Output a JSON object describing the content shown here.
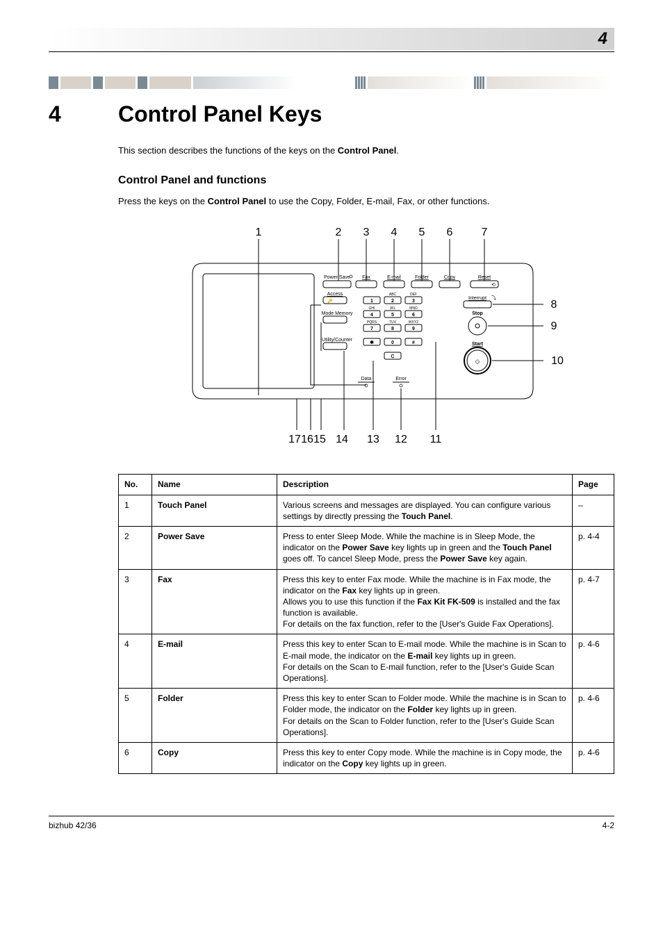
{
  "header": {
    "number": "4"
  },
  "chapter": {
    "num": "4",
    "title": "Control Panel Keys"
  },
  "intro_a": "This section describes the functions of the keys on the ",
  "intro_b": "Control Panel",
  "intro_c": ".",
  "section": {
    "title": "Control Panel and functions"
  },
  "section_desc_a": "Press the keys on the ",
  "section_desc_b": "Control Panel",
  "section_desc_c": " to use the Copy, Folder, E-mail, Fax, or other functions.",
  "diagram": {
    "top": {
      "l1": "1",
      "l2": "2",
      "l3": "3",
      "l4": "4",
      "l5": "5",
      "l6": "6",
      "l7": "7"
    },
    "right": {
      "l8": "8",
      "l9": "9",
      "l10": "10"
    },
    "bottom": {
      "l11": "11",
      "l12": "12",
      "l13": "13",
      "l14": "14",
      "l15": "15",
      "l16": "16",
      "l17": "17"
    },
    "panel": {
      "powersave": "Power Save",
      "fax": "Fax",
      "email": "E-mail",
      "folder": "Folder",
      "copy": "Copy",
      "reset": "Reset",
      "access": "Access",
      "modememory": "Mode Memory",
      "utilitycounter": "Utility/Counter",
      "interrupt": "Interrupt",
      "stop": "Stop",
      "start": "Start",
      "data": "Data",
      "error": "Error",
      "k1": "1",
      "k2": "2",
      "k3": "3",
      "k4": "4",
      "k5": "5",
      "k6": "6",
      "k7": "7",
      "k8": "8",
      "k9": "9",
      "k0": "0",
      "kstar": "✱",
      "khash": "#",
      "kc": "C",
      "abc": "ABC",
      "def": "DEF",
      "ghi": "GHI",
      "jkl": "JKL",
      "mno": "MNO",
      "pqrs": "PQRS",
      "tuv": "TUV",
      "wxyz": "WXYZ"
    }
  },
  "table": {
    "headers": {
      "no": "No.",
      "name": "Name",
      "desc": "Description",
      "page": "Page"
    },
    "rows": [
      {
        "no": "1",
        "name": "Touch Panel",
        "desc_a": "Various screens and messages are displayed. You can configure various settings by directly pressing the ",
        "desc_b": "Touch Panel",
        "desc_c": ".",
        "page": "–"
      },
      {
        "no": "2",
        "name": "Power Save",
        "desc_a": "Press to enter Sleep Mode. While the machine is in Sleep Mode, the indicator on the ",
        "desc_b": "Power Save",
        "desc_c": " key lights up in green and the ",
        "desc_d": "Touch Panel",
        "desc_e": " goes off. To cancel Sleep Mode, press the ",
        "desc_f": "Power Save",
        "desc_g": " key again.",
        "page": "p. 4-4"
      },
      {
        "no": "3",
        "name": "Fax",
        "desc_a": "Press this key to enter Fax mode. While the machine is in Fax mode, the indicator on the ",
        "desc_b": "Fax",
        "desc_c": " key lights up in green.\nAllows you to use this function if the ",
        "desc_d": "Fax Kit FK-509",
        "desc_e": " is installed and the fax function is available.\nFor details on the fax function, refer to the [User's Guide Fax Operations].",
        "page": "p. 4-7"
      },
      {
        "no": "4",
        "name": "E-mail",
        "desc_a": "Press this key to enter Scan to E-mail mode. While the machine is in Scan to E-mail mode, the indicator on the ",
        "desc_b": "E-mail",
        "desc_c": " key lights up in green.\nFor details on the Scan to E-mail function, refer to the [User's Guide Scan Operations].",
        "page": "p. 4-6"
      },
      {
        "no": "5",
        "name": "Folder",
        "desc_a": "Press this key to enter Scan to Folder mode. While the machine is in Scan to Folder mode, the indicator on the ",
        "desc_b": "Folder",
        "desc_c": " key lights up in green.\nFor details on the Scan to Folder function, refer to the [User's Guide Scan Operations].",
        "page": "p. 4-6"
      },
      {
        "no": "6",
        "name": "Copy",
        "desc_a": "Press this key to enter Copy mode. While the machine is in Copy mode, the indicator on the ",
        "desc_b": "Copy",
        "desc_c": " key lights up in green.",
        "page": "p. 4-6"
      }
    ]
  },
  "footer": {
    "left": "bizhub 42/36",
    "right": "4-2"
  }
}
